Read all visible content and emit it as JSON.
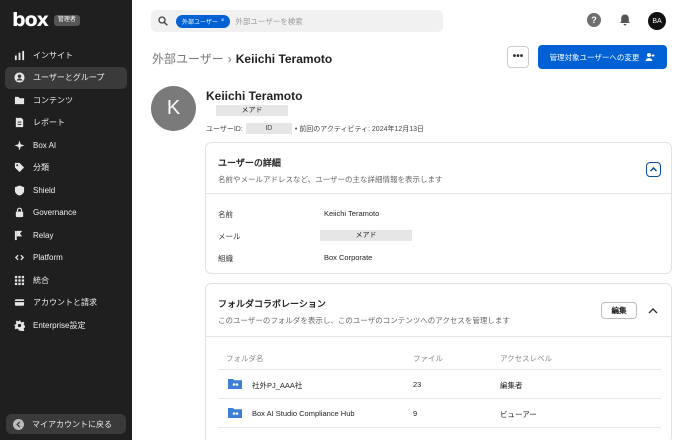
{
  "app": {
    "logo": "box",
    "admin_badge": "管理者"
  },
  "sidebar": {
    "items": [
      {
        "label": "インサイト",
        "icon": "bar-chart-icon"
      },
      {
        "label": "ユーザーとグループ",
        "icon": "user-circle-icon"
      },
      {
        "label": "コンテンツ",
        "icon": "folder-icon"
      },
      {
        "label": "レポート",
        "icon": "report-icon"
      },
      {
        "label": "Box AI",
        "icon": "ai-icon"
      },
      {
        "label": "分類",
        "icon": "tag-icon"
      },
      {
        "label": "Shield",
        "icon": "shield-icon"
      },
      {
        "label": "Governance",
        "icon": "lock-icon"
      },
      {
        "label": "Relay",
        "icon": "relay-icon"
      },
      {
        "label": "Platform",
        "icon": "platform-icon"
      },
      {
        "label": "統合",
        "icon": "grid-icon"
      },
      {
        "label": "アカウントと請求",
        "icon": "card-icon"
      },
      {
        "label": "Enterprise設定",
        "icon": "gear-icon"
      }
    ],
    "active_index": 1,
    "my_account": "マイアカウントに戻る"
  },
  "header": {
    "search_chip": "外部ユーザー",
    "search_chip_close": "×",
    "search_placeholder": "外部ユーザーを検索",
    "help": "?",
    "avatar": "BA"
  },
  "breadcrumb": {
    "parent": "外部ユーザー",
    "separator": "›",
    "current": "Keiichi Teramoto"
  },
  "actions": {
    "more": "•••",
    "manage": "管理対象ユーザーへの変更"
  },
  "profile": {
    "initial": "K",
    "name": "Keiichi Teramoto",
    "email_redacted": "メアド",
    "user_id_label": "ユーザーID:",
    "user_id_redacted": "ID",
    "last_activity": "• 前回のアクティビティ: 2024年12月13日"
  },
  "details": {
    "title": "ユーザーの詳細",
    "subtitle": "名前やメールアドレスなど、ユーザーの主な詳細情報を表示します",
    "rows": [
      {
        "label": "名前",
        "value": "Keiichi Teramoto"
      },
      {
        "label": "メール",
        "value": "メアド"
      },
      {
        "label": "組織",
        "value": "Box Corporate"
      }
    ]
  },
  "collab": {
    "title": "フォルダコラボレーション",
    "subtitle": "このユーザーのフォルダを表示し、このユーザのコンテンツへのアクセスを管理します",
    "edit": "編集",
    "columns": [
      "フォルダ名",
      "ファイル",
      "アクセスレベル"
    ],
    "rows": [
      {
        "name": "社外PJ_AAA社",
        "files": "23",
        "access": "編集者"
      },
      {
        "name": "Box AI Studio Compliance Hub",
        "files": "9",
        "access": "ビューアー"
      }
    ]
  },
  "colors": {
    "accent": "#0061d5",
    "sidebar": "#1f1f1f",
    "folder": "#3d7fd6"
  }
}
